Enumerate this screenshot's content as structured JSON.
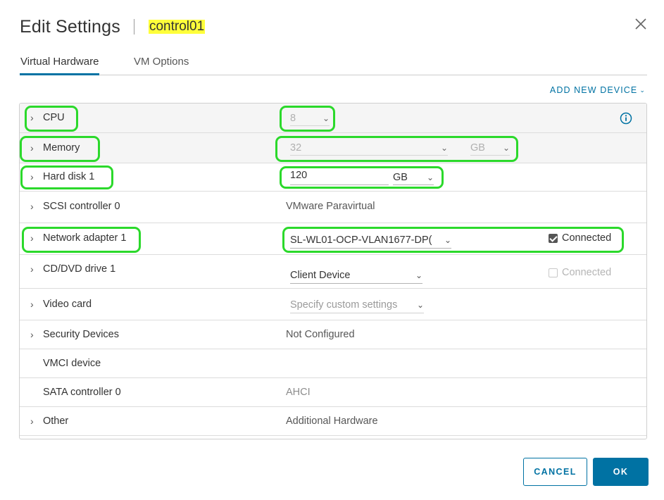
{
  "dialog": {
    "title": "Edit Settings",
    "vm_name": "control01",
    "vm_name_highlight": "#ffff3a"
  },
  "tabs": [
    {
      "label": "Virtual Hardware",
      "active": true
    },
    {
      "label": "VM Options",
      "active": false
    }
  ],
  "add_device": {
    "label": "ADD NEW DEVICE",
    "icon": "chevron-down-icon"
  },
  "rows": {
    "cpu": {
      "label": "CPU",
      "value": "8"
    },
    "memory": {
      "label": "Memory",
      "value": "32",
      "unit": "GB"
    },
    "hard_disk": {
      "label": "Hard disk 1",
      "value": "120",
      "unit": "GB"
    },
    "scsi": {
      "label": "SCSI controller 0",
      "value": "VMware Paravirtual"
    },
    "network": {
      "label": "Network adapter 1",
      "value": "SL-WL01-OCP-VLAN1677-DP(",
      "connected_label": "Connected",
      "connected": true
    },
    "cdrom": {
      "label": "CD/DVD drive 1",
      "value": "Client Device",
      "connected_label": "Connected",
      "connected": false
    },
    "video": {
      "label": "Video card",
      "value": "Specify custom settings"
    },
    "security": {
      "label": "Security Devices",
      "value": "Not Configured"
    },
    "vmci": {
      "label": "VMCI device"
    },
    "sata": {
      "label": "SATA controller 0",
      "value": "AHCI"
    },
    "other": {
      "label": "Other",
      "value": "Additional Hardware"
    }
  },
  "buttons": {
    "cancel": "CANCEL",
    "ok": "OK"
  },
  "colors": {
    "accent": "#0072a3",
    "highlight_outline": "#2bd92b"
  }
}
